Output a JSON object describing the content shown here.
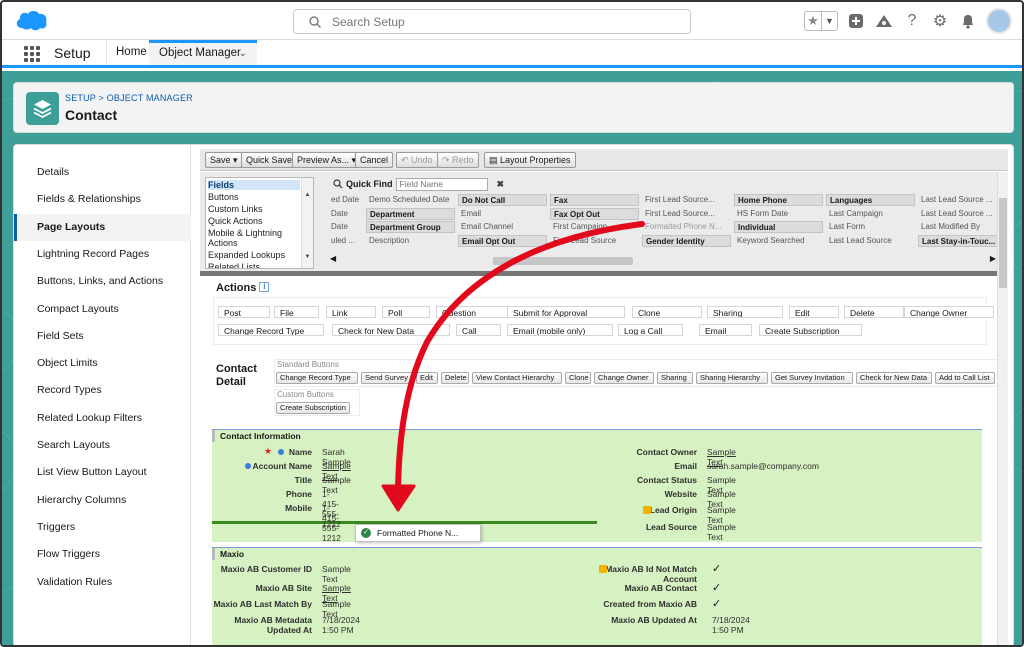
{
  "search": {
    "placeholder": "Search Setup"
  },
  "nav": {
    "app_name": "Setup",
    "home": "Home",
    "object_manager": "Object Manager"
  },
  "header": {
    "breadcrumb": "SETUP > OBJECT MANAGER",
    "title": "Contact"
  },
  "sidebar": {
    "items": [
      "Details",
      "Fields & Relationships",
      "Page Layouts",
      "Lightning Record Pages",
      "Buttons, Links, and Actions",
      "Compact Layouts",
      "Field Sets",
      "Object Limits",
      "Record Types",
      "Related Lookup Filters",
      "Search Layouts",
      "List View Button Layout",
      "Hierarchy Columns",
      "Triggers",
      "Flow Triggers",
      "Validation Rules"
    ],
    "active": "Page Layouts"
  },
  "toolbar": {
    "save": "Save",
    "quick_save": "Quick Save",
    "preview_as": "Preview As...",
    "cancel": "Cancel",
    "undo": "Undo",
    "redo": "Redo",
    "layout_properties": "Layout Properties"
  },
  "palette": {
    "categories": [
      "Fields",
      "Buttons",
      "Custom Links",
      "Quick Actions",
      "Mobile & Lightning Actions",
      "Expanded Lookups",
      "Related Lists"
    ],
    "quick_find_label": "Quick Find",
    "quick_find_placeholder": "Field Name",
    "rows": [
      [
        "ed Date",
        "Demo Scheduled Date",
        "Do Not Call",
        "Fax",
        "First Lead Source...",
        "Home Phone",
        "Languages",
        "Last Lead Source ..."
      ],
      [
        "Date",
        "Department",
        "Email",
        "Fax Opt Out",
        "First Lead Source...",
        "HS Form Date",
        "Last Campaign",
        "Last Lead Source ..."
      ],
      [
        "Date",
        "Department Group",
        "Email Channel",
        "First Campaign",
        "Formatted Phone N...",
        "Individual",
        "Last Form",
        "Last Modified By"
      ],
      [
        "uled ...",
        "Description",
        "Email Opt Out",
        "First Lead Source",
        "Gender Identity",
        "Keyword Searched",
        "Last Lead Source",
        "Last Stay-in-Touc..."
      ]
    ],
    "bold_cells": [
      [
        false,
        false,
        true,
        true,
        false,
        true,
        true,
        false
      ],
      [
        false,
        true,
        false,
        true,
        false,
        false,
        false,
        false
      ],
      [
        false,
        true,
        false,
        false,
        false,
        true,
        false,
        false
      ],
      [
        false,
        false,
        true,
        false,
        true,
        false,
        false,
        true
      ]
    ]
  },
  "actions": {
    "title": "Actions",
    "row1": [
      "Post",
      "File",
      "Link",
      "Poll",
      "Question",
      "Submit for Approval",
      "Clone",
      "Sharing",
      "Edit",
      "Delete",
      "Change Owner"
    ],
    "row2": [
      "Change Record Type",
      "Check for New Data",
      "Call",
      "Email (mobile only)",
      "Log a Call",
      "Email",
      "Create Subscription"
    ]
  },
  "contact_detail": {
    "title_line1": "Contact",
    "title_line2": "Detail",
    "standard_label": "Standard Buttons",
    "standard_buttons": [
      "Change Record Type",
      "Send Survey",
      "Edit",
      "Delete",
      "View Contact Hierarchy",
      "Clone",
      "Change Owner",
      "Sharing",
      "Sharing Hierarchy",
      "Get Survey Invitation",
      "Check for New Data",
      "Add to Call List"
    ],
    "custom_label": "Custom Buttons",
    "custom_buttons": [
      "Create Subscription"
    ]
  },
  "contact_info": {
    "title": "Contact Information",
    "left": [
      {
        "label": "Name",
        "value": "Sarah Sample"
      },
      {
        "label": "Account Name",
        "value": "Sample Text"
      },
      {
        "label": "Title",
        "value": "Sample Text"
      },
      {
        "label": "Phone",
        "value": "1-415-555-1212"
      },
      {
        "label": "Mobile",
        "value": "1-415-555-1212"
      }
    ],
    "right": [
      {
        "label": "Contact Owner",
        "value": "Sample Text"
      },
      {
        "label": "Email",
        "value": "sarah.sample@company.com"
      },
      {
        "label": "Contact Status",
        "value": "Sample Text"
      },
      {
        "label": "Website",
        "value": "Sample Text"
      },
      {
        "label": "Lead Origin",
        "value": "Sample Text"
      },
      {
        "label": "Lead Source",
        "value": "Sample Text"
      }
    ]
  },
  "maxio": {
    "title": "Maxio",
    "left": [
      {
        "label": "Maxio AB Customer ID",
        "value": "Sample Text"
      },
      {
        "label": "Maxio AB Site",
        "value": "Sample Text"
      },
      {
        "label": "Maxio AB Last Match By",
        "value": "Sample Text"
      },
      {
        "label": "Maxio AB Metadata Updated At",
        "value": "7/18/2024 1:50 PM"
      }
    ],
    "right": [
      {
        "label": "Maxio AB Id Not Match Account",
        "value": "✓"
      },
      {
        "label": "Maxio AB Contact",
        "value": "✓"
      },
      {
        "label": "Created from Maxio AB",
        "value": "✓"
      },
      {
        "label": "Maxio AB Updated At",
        "value": "7/18/2024 1:50 PM"
      }
    ]
  },
  "drag_item": {
    "label": "Formatted Phone N..."
  },
  "colors": {
    "teal": "#3d9f97",
    "brand_blue": "#1b96ff",
    "section_green": "#d6f1c2",
    "arrow_red": "#e3091c"
  },
  "icons": [
    "salesforce-cloud-icon",
    "search-icon",
    "star-icon",
    "plus-icon",
    "trailhead-icon",
    "help-icon",
    "gear-icon",
    "bell-icon",
    "avatar-icon",
    "waffle-icon",
    "layers-icon",
    "checkmark-icon",
    "lock-icon"
  ]
}
